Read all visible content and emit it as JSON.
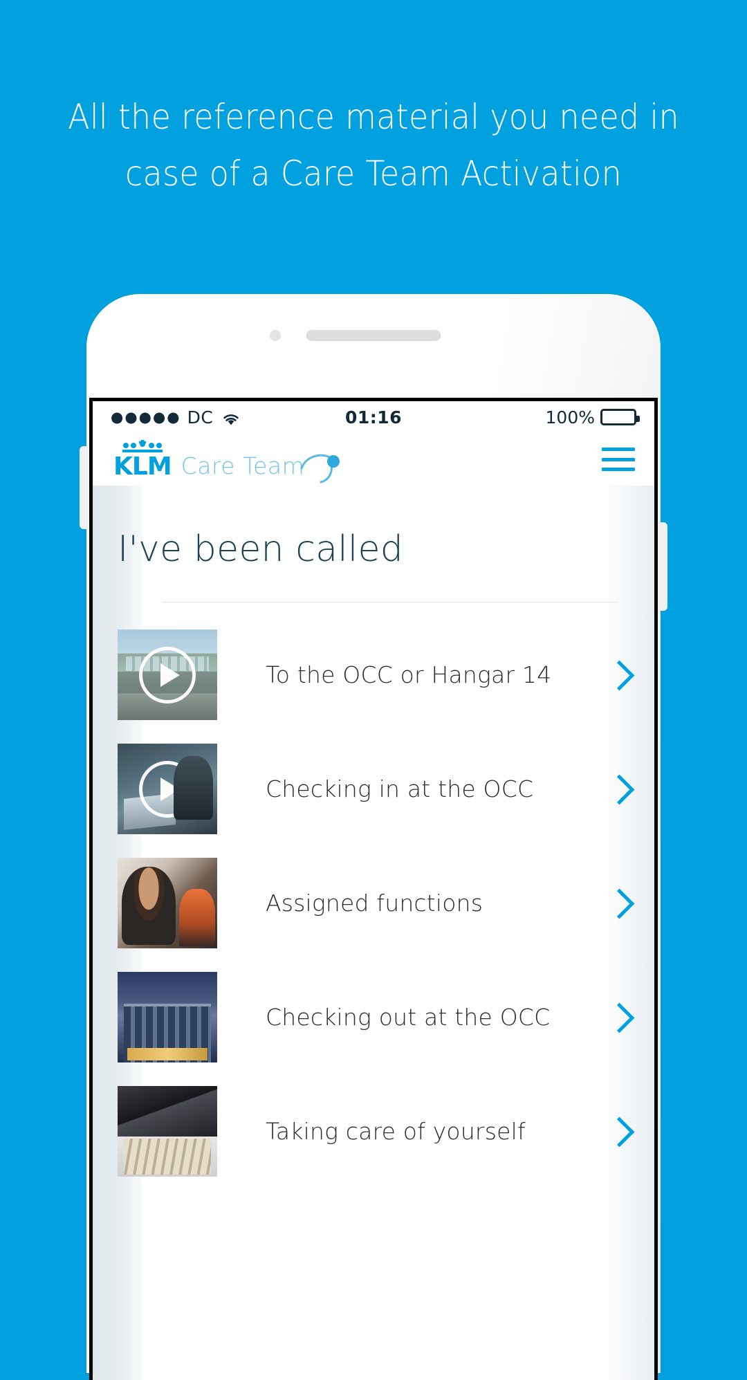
{
  "headline": {
    "line1": "All the reference material you need in",
    "line2": "case of a Care Team Activation"
  },
  "colors": {
    "brand_blue": "#00A1DE",
    "title_slate": "#1C4254",
    "accent_chevron": "#00A1DE",
    "care_team_light": "#74C4E8"
  },
  "status_bar": {
    "signal_dots": "●●●●●",
    "carrier": "DC",
    "wifi_icon": "wifi-icon",
    "time": "01:16",
    "battery_percent": "100%",
    "battery_icon": "battery-full-icon"
  },
  "app_bar": {
    "logo_text": "KLM",
    "logo_crown_icon": "klm-crown-icon",
    "product_name": "Care Team",
    "swoosh_icon": "care-team-swoosh-icon",
    "menu_icon": "hamburger-menu-icon"
  },
  "page": {
    "title": "I've been called"
  },
  "list": {
    "items": [
      {
        "label": "To the OCC or Hangar 14",
        "has_video": true,
        "thumb_class": "img-occ",
        "thumb_name": "thumbnail-occ-building",
        "chevron": "chevron-right-icon"
      },
      {
        "label": "Checking in at the OCC",
        "has_video": true,
        "thumb_class": "img-checkin",
        "thumb_name": "thumbnail-checking-in",
        "chevron": "chevron-right-icon"
      },
      {
        "label": "Assigned functions",
        "has_video": false,
        "thumb_class": "img-people",
        "thumb_name": "thumbnail-people",
        "chevron": "chevron-right-icon"
      },
      {
        "label": "Checking out at the OCC",
        "has_video": false,
        "thumb_class": "img-building",
        "thumb_name": "thumbnail-occ-exterior",
        "chevron": "chevron-right-icon"
      },
      {
        "label": "Taking care of yourself",
        "has_video": false,
        "thumb_class": "img-domino",
        "thumb_name": "thumbnail-dominoes",
        "chevron": "chevron-right-icon"
      }
    ]
  }
}
